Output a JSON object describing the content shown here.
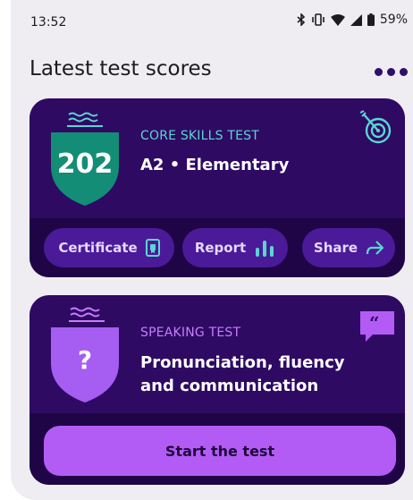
{
  "status": {
    "time": "13:52",
    "battery": "59%",
    "icons": [
      "bluetooth-icon",
      "vibrate-icon",
      "wifi-icon",
      "signal-icon",
      "battery-icon"
    ]
  },
  "header": {
    "title": "Latest test scores",
    "more_icon": "more-horizontal-icon"
  },
  "core_card": {
    "score": "202",
    "kicker": "CORE SKILLS TEST",
    "title": "A2 • Elementary",
    "icon": "target-icon",
    "actions": [
      {
        "label": "Certificate",
        "icon": "certificate-icon"
      },
      {
        "label": "Report",
        "icon": "bar-chart-icon"
      },
      {
        "label": "Share",
        "icon": "share-icon"
      }
    ]
  },
  "speaking_card": {
    "badge": "?",
    "kicker": "SPEAKING TEST",
    "title_line1": "Pronunciation, fluency",
    "title_line2": "and communication",
    "icon": "quote-icon",
    "cta": "Start the test"
  },
  "colors": {
    "card_bg": "#2e0a63",
    "card_footer": "#1f0546",
    "core_accent": "#5bd6d1",
    "core_badge": "#138d75",
    "speaking_accent": "#c97cff",
    "speaking_badge": "#a55df2",
    "cta": "#b35cf5"
  }
}
